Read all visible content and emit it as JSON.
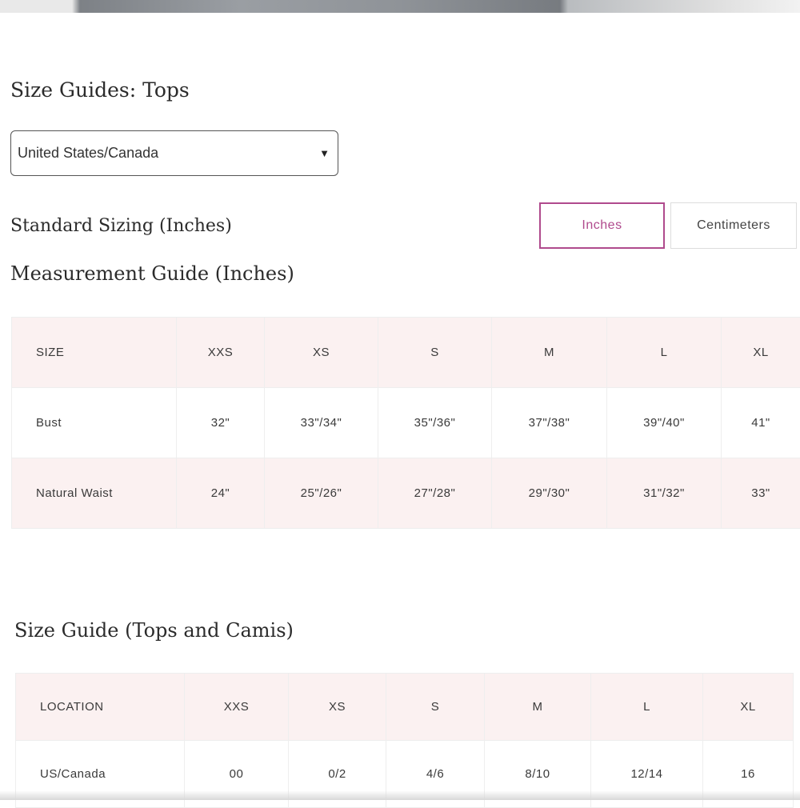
{
  "page_title": "Size Guides: Tops",
  "region_select": {
    "selected": "United States/Canada",
    "caret": "▼"
  },
  "standard_sizing": "Standard Sizing (Inches)",
  "unit_toggle": {
    "inches": "Inches",
    "centimeters": "Centimeters",
    "active": "Inches",
    "active_color": "#b04a8d"
  },
  "measurement_guide": {
    "title": "Measurement Guide (Inches)",
    "header": [
      "SIZE",
      "XXS",
      "XS",
      "S",
      "M",
      "L",
      "XL"
    ],
    "rows": [
      [
        "Bust",
        "32\"",
        "33\"/34\"",
        "35\"/36\"",
        "37\"/38\"",
        "39\"/40\"",
        "41\""
      ],
      [
        "Natural Waist",
        "24\"",
        "25\"/26\"",
        "27\"/28\"",
        "29\"/30\"",
        "31\"/32\"",
        "33\""
      ]
    ]
  },
  "tops_camis_guide": {
    "title": "Size Guide (Tops and Camis)",
    "header": [
      "LOCATION",
      "XXS",
      "XS",
      "S",
      "M",
      "L",
      "XL"
    ],
    "rows": [
      [
        "US/Canada",
        "00",
        "0/2",
        "4/6",
        "8/10",
        "12/14",
        "16"
      ]
    ]
  },
  "colors": {
    "header_row_bg": "#fbf1f1",
    "accent": "#b04a8d"
  }
}
